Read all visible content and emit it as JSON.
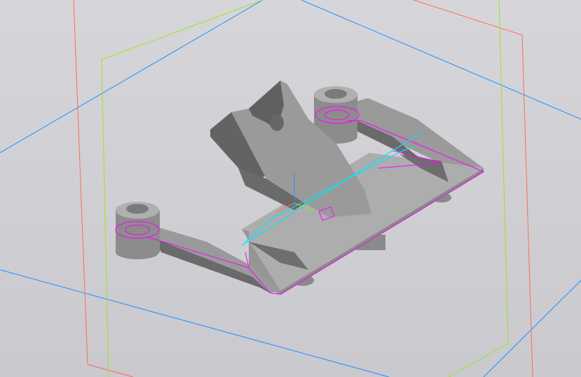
{
  "viewport": {
    "background": "#d0d0d4",
    "colors": {
      "plane_xy": "#1e90ff",
      "plane_xz": "#ff6a5a",
      "plane_yz": "#9be61e",
      "sketch": "#ff00ff",
      "axis_line": "#00e5ff",
      "part_light": "#a9a9a9",
      "part_mid": "#8f8f8f",
      "part_dark": "#6a6a6a"
    }
  }
}
